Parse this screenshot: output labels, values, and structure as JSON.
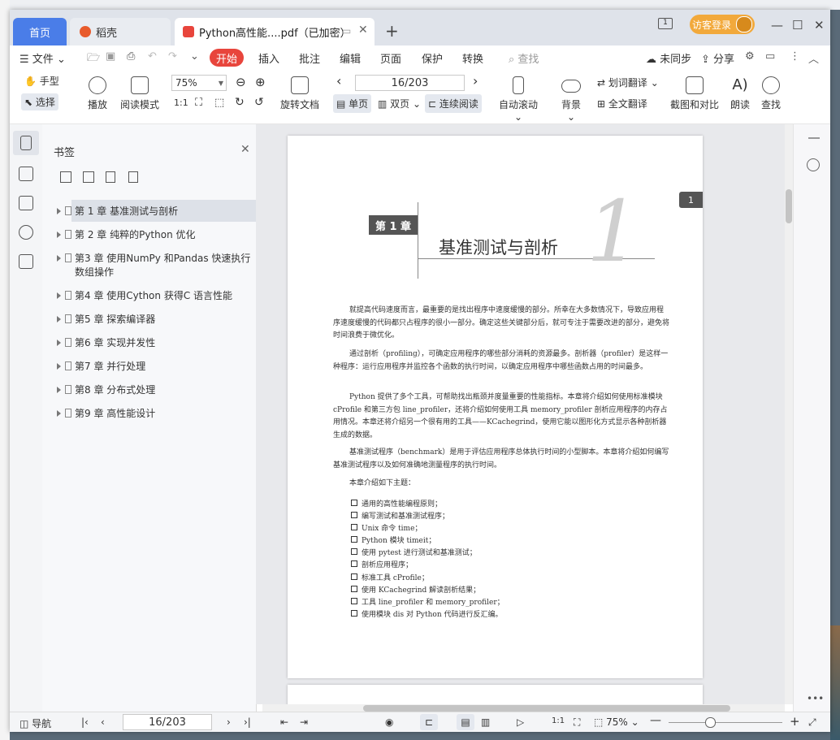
{
  "tabs": {
    "home": "首页",
    "daoke": "稻壳",
    "pdf": "Python高性能....pdf（已加密）"
  },
  "header": {
    "guest_login": "访客登录",
    "page_badge": "1"
  },
  "menu": {
    "file": "文件",
    "items": [
      "开始",
      "插入",
      "批注",
      "编辑",
      "页面",
      "保护",
      "转换"
    ],
    "search": "查找",
    "unsync": "未同步",
    "share": "分享"
  },
  "toolbar": {
    "hand": "手型",
    "select": "选择",
    "play": "播放",
    "read_mode": "阅读模式",
    "zoom_value": "75%",
    "rotate": "旋转文档",
    "page_value": "16/203",
    "single": "单页",
    "double": "双页",
    "continuous": "连续阅读",
    "auto_scroll": "自动滚动",
    "background": "背景",
    "word_translate": "划词翻译",
    "full_translate": "全文翻译",
    "screenshot": "截图和对比",
    "read_aloud": "朗读",
    "find": "查找"
  },
  "bookmarks": {
    "title": "书签",
    "items": [
      "第 1 章 基准测试与剖析",
      "第 2 章 纯粹的Python 优化",
      "第3 章 使用NumPy 和Pandas 快速执行数组操作",
      "第4 章 使用Cython 获得C 语言性能",
      "第5 章 探索编译器",
      "第6 章 实现并发性",
      "第7 章 并行处理",
      "第8 章 分布式处理",
      "第9 章 高性能设计"
    ]
  },
  "document": {
    "chapter_label": "第 1 章",
    "chapter_title": "基准测试与剖析",
    "chapter_number": "1",
    "corner_number": "1",
    "para1": "就提高代码速度而言，最重要的是找出程序中速度缓慢的部分。所幸在大多数情况下，导致应用程序速度缓慢的代码都只占程序的很小一部分。确定这些关键部分后，就可专注于需要改进的部分，避免将时间浪费于微优化。",
    "para2": "通过剖析（profiling），可确定应用程序的哪些部分消耗的资源最多。剖析器（profiler）是这样一种程序：运行应用程序并监控各个函数的执行时间，以确定应用程序中哪些函数占用的时间最多。",
    "para3": "Python 提供了多个工具，可帮助找出瓶颈并度量重要的性能指标。本章将介绍如何使用标准模块 cProfile 和第三方包 line_profiler，还将介绍如何使用工具 memory_profiler 剖析应用程序的内存占用情况。本章还将介绍另一个很有用的工具——KCachegrind，使用它能以图形化方式显示各种剖析器生成的数据。",
    "para4": "基准测试程序（benchmark）是用于评估应用程序总体执行时间的小型脚本。本章将介绍如何编写基准测试程序以及如何准确地测量程序的执行时间。",
    "intro": "本章介绍如下主题：",
    "topics": [
      "通用的高性能编程原则；",
      "编写测试和基准测试程序；",
      "Unix 命令 time；",
      "Python 模块 timeit；",
      "使用 pytest 进行测试和基准测试；",
      "剖析应用程序；",
      "标准工具 cProfile；",
      "使用 KCachegrind 解读剖析结果；",
      "工具 line_profiler 和 memory_profiler；",
      "使用模块 dis 对 Python 代码进行反汇编。"
    ]
  },
  "statusbar": {
    "nav": "导航",
    "page_value": "16/203",
    "zoom": "75%"
  },
  "colors": {
    "accent": "#4a7de8",
    "start": "#e8453c",
    "guest": "#f2a93b"
  }
}
